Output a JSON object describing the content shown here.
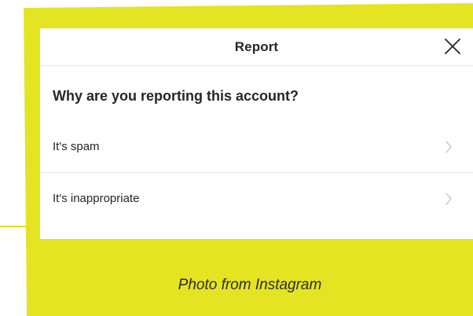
{
  "dialog": {
    "title": "Report",
    "close_icon": "close-icon",
    "question": "Why are you reporting this account?",
    "options": [
      {
        "label": "It's spam",
        "icon": "chevron-right-icon"
      },
      {
        "label": "It's inappropriate",
        "icon": "chevron-right-icon"
      }
    ]
  },
  "caption": "Photo from Instagram",
  "colors": {
    "accent": "#e4e423",
    "text": "#262626",
    "divider": "#e6e6e6",
    "chevron": "#c7c7c7"
  }
}
